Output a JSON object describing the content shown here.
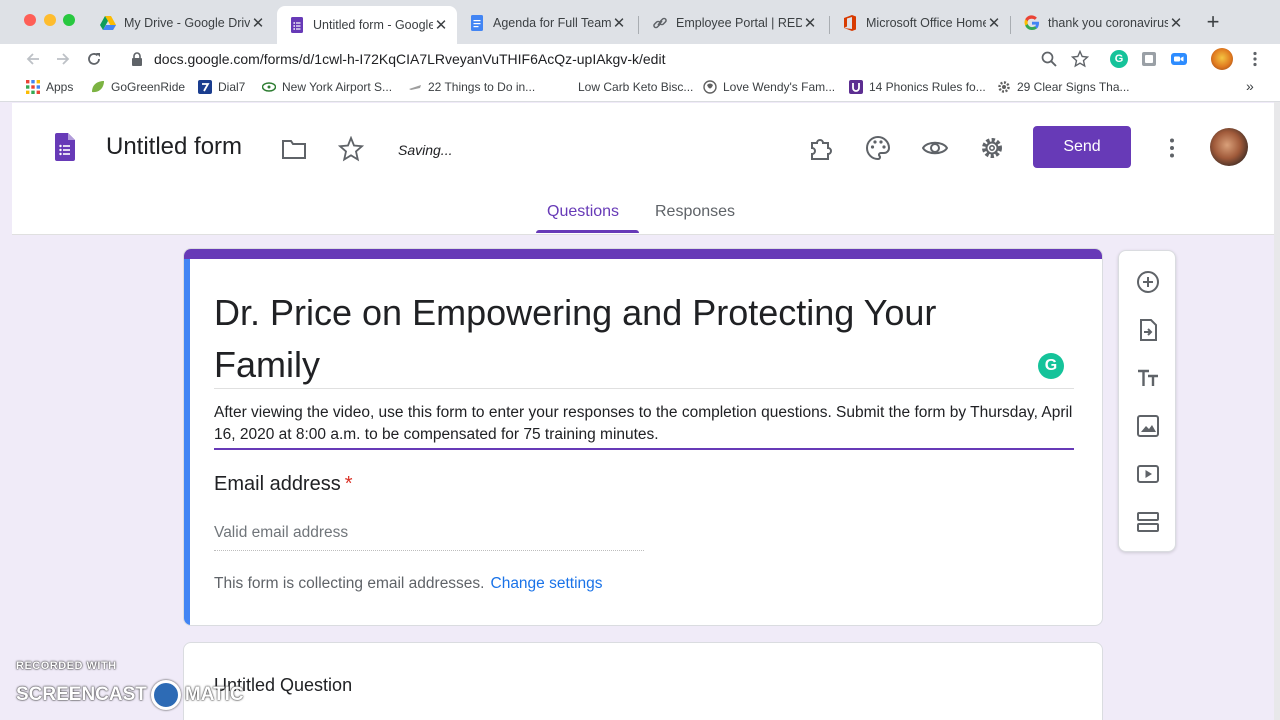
{
  "browser": {
    "tabs": [
      {
        "title": "My Drive - Google Drive",
        "icon": "google-drive-icon"
      },
      {
        "title": "Untitled form - Google F",
        "icon": "google-forms-icon",
        "active": true
      },
      {
        "title": "Agenda for Full Team Z",
        "icon": "google-docs-icon"
      },
      {
        "title": "Employee Portal | REDI",
        "icon": "link-icon"
      },
      {
        "title": "Microsoft Office Home",
        "icon": "office-icon"
      },
      {
        "title": "thank you coronavirus h",
        "icon": "google-icon"
      }
    ],
    "close_glyph": "✕",
    "new_tab_glyph": "+",
    "url": "docs.google.com/forms/d/1cwl-h-I72KqCIA7LRveyanVuTHIF6AcQz-upIAkgv-k/edit",
    "bookmarks": [
      {
        "label": "Apps",
        "icon": "apps-grid-icon"
      },
      {
        "label": "GoGreenRide",
        "icon": "leaf-icon"
      },
      {
        "label": "Dial7",
        "icon": "dial7-icon"
      },
      {
        "label": "New York Airport S...",
        "icon": "airport-icon"
      },
      {
        "label": "22 Things to Do in...",
        "icon": "plane-icon"
      },
      {
        "label": "Low Carb Keto Bisc...",
        "icon": "blank-page-icon"
      },
      {
        "label": "Love Wendy's Fam...",
        "icon": "food-icon"
      },
      {
        "label": "14 Phonics Rules fo...",
        "icon": "u-icon"
      },
      {
        "label": "29 Clear Signs Tha...",
        "icon": "gear-favicon-icon"
      }
    ],
    "more_bookmarks_glyph": "»"
  },
  "forms": {
    "title": "Untitled form",
    "status": "Saving...",
    "send_label": "Send",
    "tabs": {
      "questions": "Questions",
      "responses": "Responses"
    },
    "accent_color": "#673ab7",
    "background_color": "#f0ebf8"
  },
  "card": {
    "title": "Dr. Price on Empowering and Protecting Your Family",
    "description": "After viewing the video, use this form to enter your responses to the completion questions. Submit the form by Thursday, April 16, 2020 at 8:00 a.m. to be compensated for 75 training minutes.",
    "email_label": "Email address",
    "required_mark": "*",
    "email_placeholder": "Valid email address",
    "collect_note": "This form is collecting email addresses.",
    "change_settings": "Change settings",
    "grammarly_letter": "G"
  },
  "next_card": {
    "title": "Untitled Question"
  },
  "watermark": {
    "line1": "RECORDED WITH",
    "line2_left": "SCREENCAST",
    "line2_right": "MATIC"
  }
}
